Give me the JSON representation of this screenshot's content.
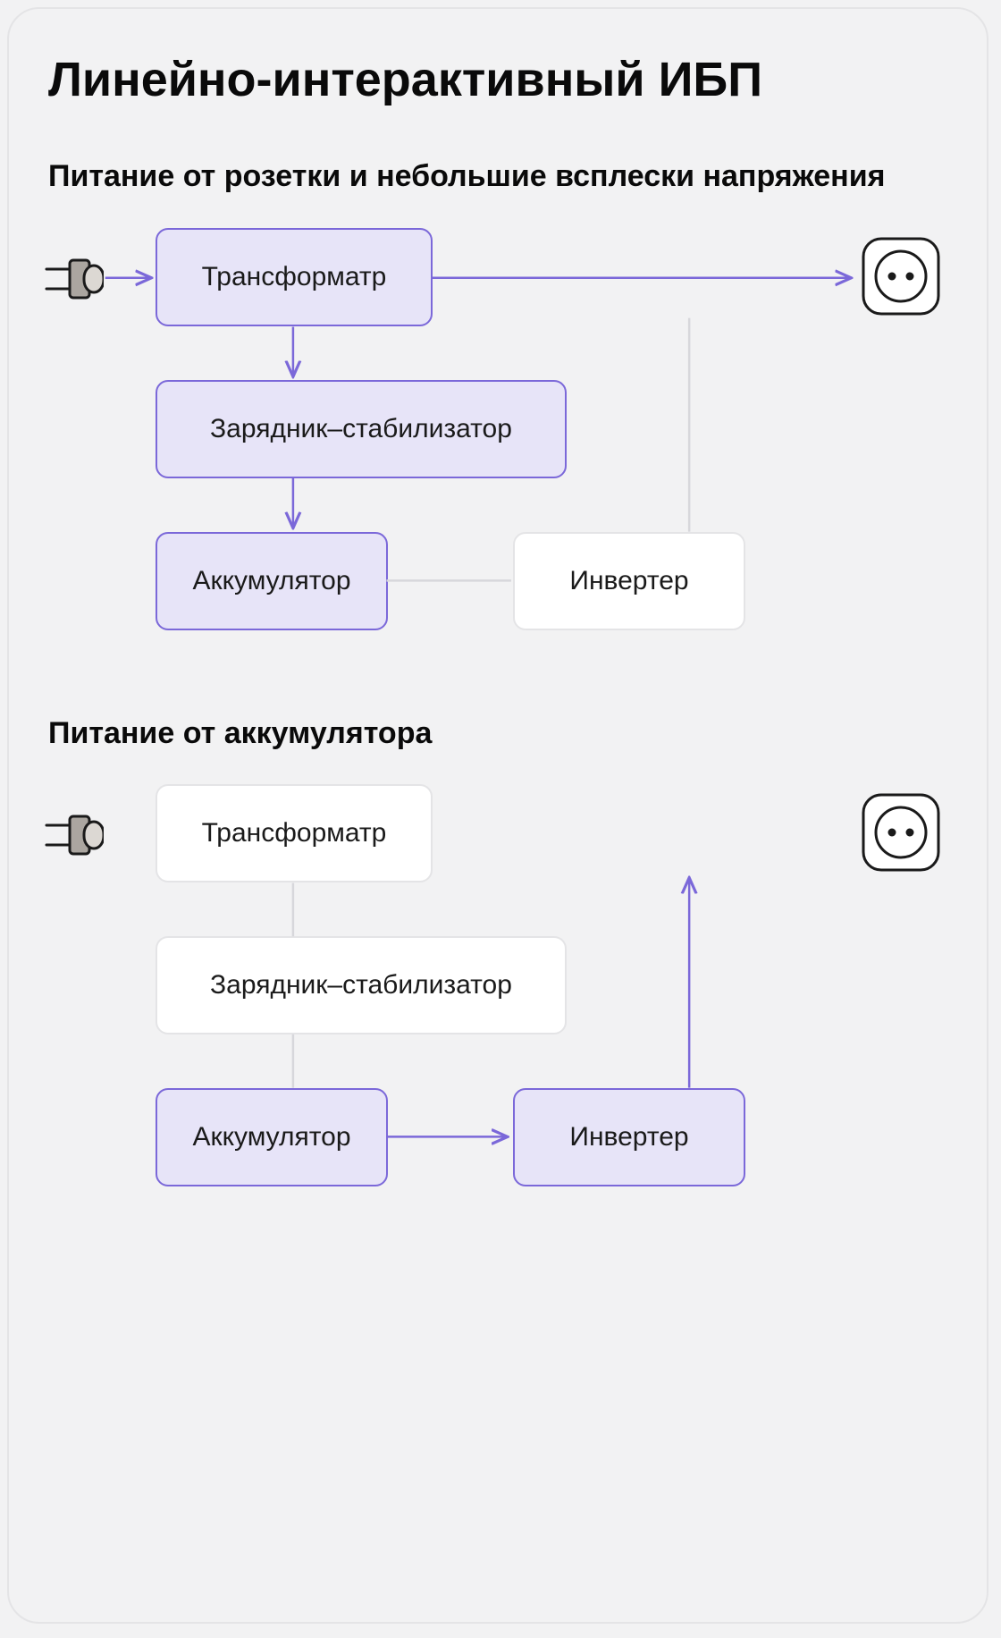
{
  "title": "Линейно-интерактивный ИБП",
  "section1": {
    "heading": "Питание от розетки и небольшие всплески напряжения",
    "nodes": {
      "transformer": "Трансформатр",
      "charger": "Зарядник–стабилизатор",
      "battery": "Аккумулятор",
      "inverter": "Инвертер"
    }
  },
  "section2": {
    "heading": "Питание от аккумулятора",
    "nodes": {
      "transformer": "Трансформатр",
      "charger": "Зарядник–стабилизатор",
      "battery": "Аккумулятор",
      "inverter": "Инвертер"
    }
  },
  "colors": {
    "activeBorder": "#7b68d9",
    "activeFill": "#e7e4f8",
    "inactiveBorder": "#e4e4e6",
    "inactiveFill": "#ffffff",
    "text": "#0a0a0a"
  }
}
